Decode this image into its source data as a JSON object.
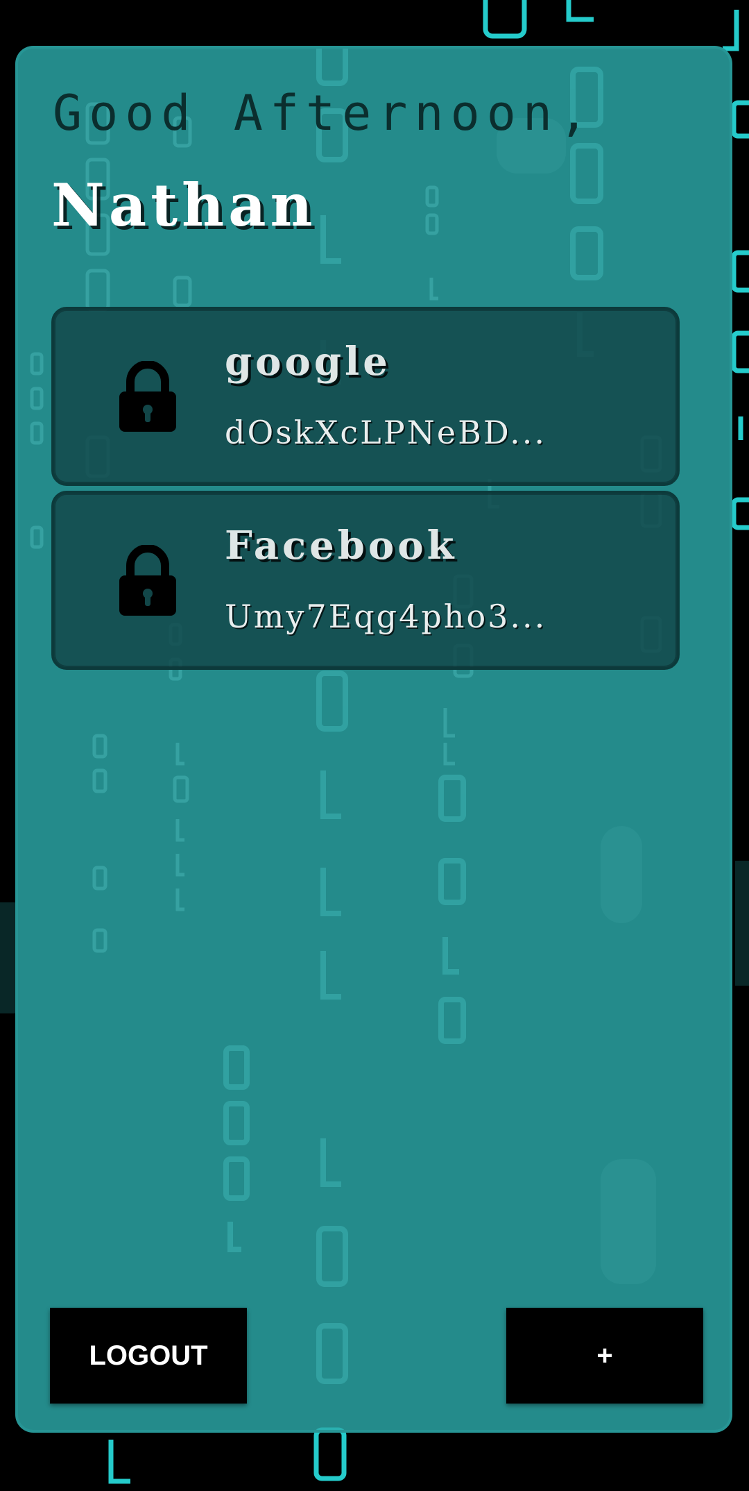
{
  "greeting": "Good Afternoon,",
  "username": "Nathan",
  "entries": [
    {
      "name": "google",
      "password_preview": "dOskXcLPNeBD...",
      "icon": "lock-icon"
    },
    {
      "name": "Facebook",
      "password_preview": "Umy7Eqg4pho3...",
      "icon": "lock-icon"
    }
  ],
  "buttons": {
    "logout_label": "LOGOUT",
    "add_label": "+"
  },
  "colors": {
    "background": "#000000",
    "panel": "#2caaaa",
    "entry_card": "#124648",
    "digits": "#27d6d6"
  },
  "background_decoration": "binary-digits"
}
